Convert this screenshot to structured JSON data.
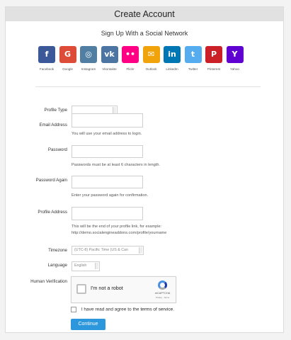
{
  "header": {
    "title": "Create Account"
  },
  "social": {
    "title": "Sign Up With a Social Network",
    "networks": [
      {
        "name": "Facebook",
        "glyph": "f",
        "color": "#3b5998"
      },
      {
        "name": "Google",
        "glyph": "G",
        "color": "#dd4b39"
      },
      {
        "name": "Instagram",
        "glyph": "◎",
        "color": "#517fa4"
      },
      {
        "name": "Vkontakte",
        "glyph": "vk",
        "color": "#4c75a3"
      },
      {
        "name": "Flickr",
        "glyph": "••",
        "color": "#ff0084"
      },
      {
        "name": "Outlook",
        "glyph": "✉",
        "color": "#f0a30a"
      },
      {
        "name": "LinkedIn",
        "glyph": "in",
        "color": "#0077b5"
      },
      {
        "name": "Twitter",
        "glyph": "t",
        "color": "#55acee"
      },
      {
        "name": "Pinterest",
        "glyph": "P",
        "color": "#cb2027"
      },
      {
        "name": "Yahoo",
        "glyph": "Y",
        "color": "#5f01d1"
      }
    ]
  },
  "form": {
    "profile_type": {
      "label": "Profile Type",
      "value": ""
    },
    "email": {
      "label": "Email Address",
      "value": "",
      "hint": "You will use your email address to login."
    },
    "password": {
      "label": "Password",
      "value": "",
      "hint": "Passwords must be at least 6 characters in length."
    },
    "password_again": {
      "label": "Password Again",
      "value": "",
      "hint": "Enter your password again for confirmation."
    },
    "profile_address": {
      "label": "Profile Address",
      "value": "",
      "hint_line1": "This will be the end of your profile link, for example:",
      "hint_line2": "http://demo.socialengineaddons.com/profile/yourname"
    },
    "timezone": {
      "label": "Timezone",
      "value": "(UTC-8) Pacific Time (US & Can"
    },
    "language": {
      "label": "Language",
      "value": "English"
    },
    "human_verification": {
      "label": "Human Verification",
      "checkbox_text": "I'm not a robot",
      "brand": "reCAPTCHA",
      "terms": "Privacy - Terms"
    },
    "agree": {
      "prefix": "I have read and agree to the",
      "link": "terms of service",
      "suffix": "."
    },
    "submit_label": "Continue"
  }
}
